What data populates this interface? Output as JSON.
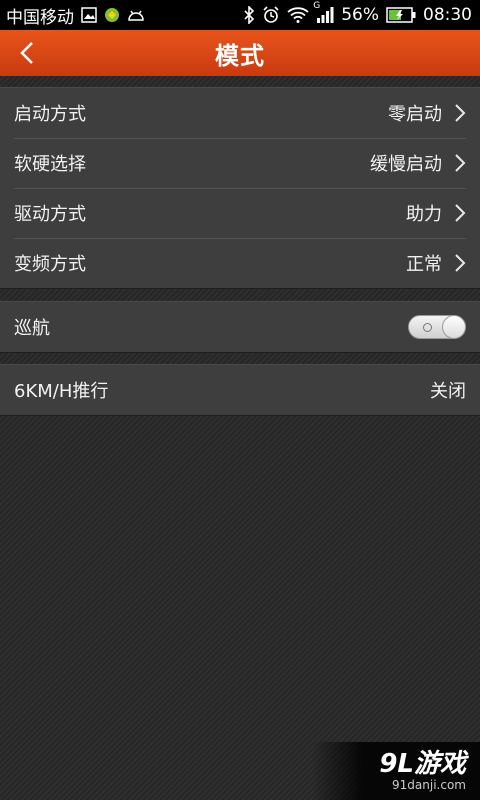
{
  "status_bar": {
    "carrier": "中国移动",
    "network": "G",
    "battery": "56%",
    "time": "08:30",
    "icons": [
      "image-icon",
      "app-notification-icon",
      "android-icon",
      "bluetooth-icon",
      "alarm-icon",
      "wifi-icon",
      "signal-icon",
      "battery-icon"
    ]
  },
  "header": {
    "title": "模式",
    "background": "#d9461a"
  },
  "settings": {
    "group1": [
      {
        "label": "启动方式",
        "value": "零启动"
      },
      {
        "label": "软硬选择",
        "value": "缓慢启动"
      },
      {
        "label": "驱动方式",
        "value": "助力"
      },
      {
        "label": "变频方式",
        "value": "正常"
      }
    ],
    "cruise": {
      "label": "巡航",
      "enabled": false
    },
    "push": {
      "label": "6KM/H推行",
      "value": "关闭"
    }
  },
  "watermark": {
    "brand": "9L游戏",
    "url": "91danji.com"
  }
}
